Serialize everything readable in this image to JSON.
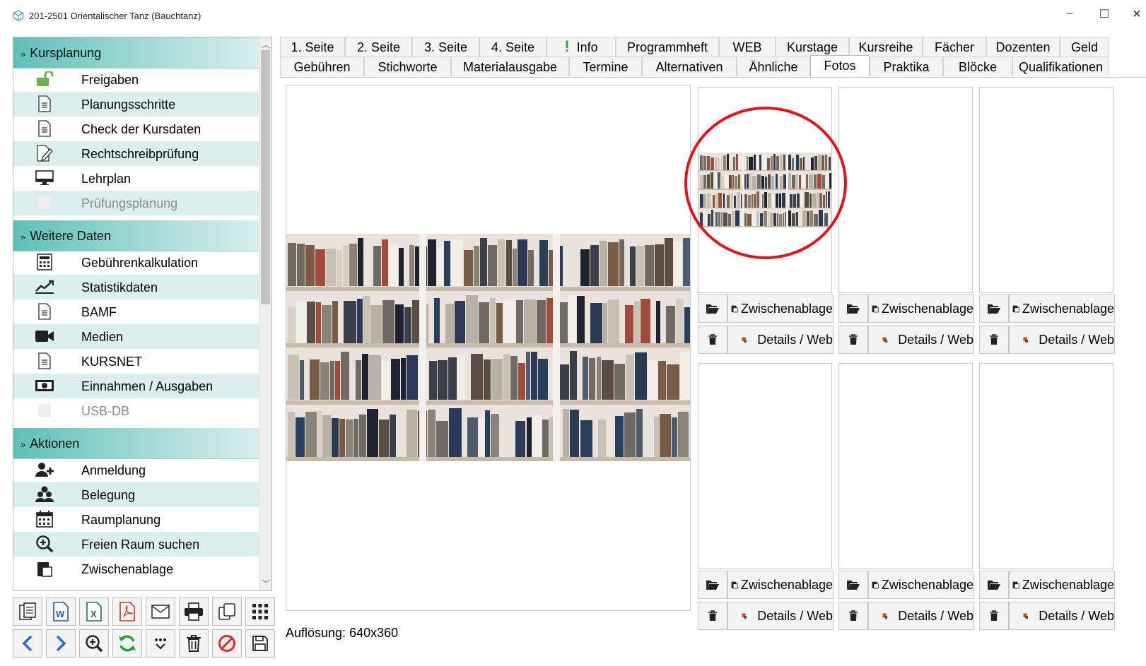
{
  "window": {
    "title": "201-2501 Orientalischer Tanz (Bauchtanz)",
    "minimize": "–",
    "maximize": "☐",
    "close": "✕"
  },
  "sidebar": {
    "sections": [
      {
        "title": "Kursplanung",
        "items": [
          {
            "label": "Freigaben",
            "icon": "unlock-icon"
          },
          {
            "label": "Planungsschritte",
            "icon": "document-icon"
          },
          {
            "label": "Check der Kursdaten",
            "icon": "document-icon"
          },
          {
            "label": "Rechtschreibprüfung",
            "icon": "edit-document-icon"
          },
          {
            "label": "Lehrplan",
            "icon": "monitor-icon"
          },
          {
            "label": "Prüfungsplanung",
            "icon": "blank-icon"
          }
        ]
      },
      {
        "title": "Weitere Daten",
        "items": [
          {
            "label": "Gebührenkalkulation",
            "icon": "calculator-icon"
          },
          {
            "label": "Statistikdaten",
            "icon": "chart-icon"
          },
          {
            "label": "BAMF",
            "icon": "document-icon"
          },
          {
            "label": "Medien",
            "icon": "video-camera-icon"
          },
          {
            "label": "KURSNET",
            "icon": "document-icon"
          },
          {
            "label": "Einnahmen / Ausgaben",
            "icon": "money-icon"
          },
          {
            "label": "USB-DB",
            "icon": "blank-icon"
          }
        ]
      },
      {
        "title": "Aktionen",
        "items": [
          {
            "label": "Anmeldung",
            "icon": "add-user-icon"
          },
          {
            "label": "Belegung",
            "icon": "users-icon"
          },
          {
            "label": "Raumplanung",
            "icon": "calendar-icon"
          },
          {
            "label": "Freien Raum suchen",
            "icon": "zoom-in-icon"
          },
          {
            "label": "Zwischenablage",
            "icon": "clipboard-icon"
          }
        ]
      }
    ]
  },
  "toolbar": {
    "row1": [
      "copy-icon",
      "word-icon",
      "excel-icon",
      "pdf-icon",
      "mail-icon",
      "print-icon",
      "duplicate-icon",
      "grid-icon"
    ],
    "row2": [
      "back-icon",
      "forward-icon",
      "zoom-icon",
      "refresh-icon",
      "more-icon",
      "trash-icon",
      "cancel-icon",
      "save-icon"
    ]
  },
  "tabs": {
    "row1": [
      "1. Seite",
      "2. Seite",
      "3. Seite",
      "4. Seite",
      "Info",
      "Programmheft",
      "WEB",
      "Kurstage",
      "Kursreihe",
      "Fächer",
      "Dozenten",
      "Geld"
    ],
    "row2": [
      "Gebühren",
      "Stichworte",
      "Materialausgabe",
      "Termine",
      "Alternativen",
      "Ähnliche",
      "Fotos",
      "Praktika",
      "Blöcke",
      "Qualifikationen"
    ],
    "active": "Fotos",
    "info_mark": "!"
  },
  "photos": {
    "resolution": "Auflösung: 640x360",
    "clipboard_label": "Zwischenablage",
    "details_label": "Details / Web",
    "colors": {
      "accent": "#5ec0b8",
      "highlight_circle": "#e0141b"
    }
  }
}
